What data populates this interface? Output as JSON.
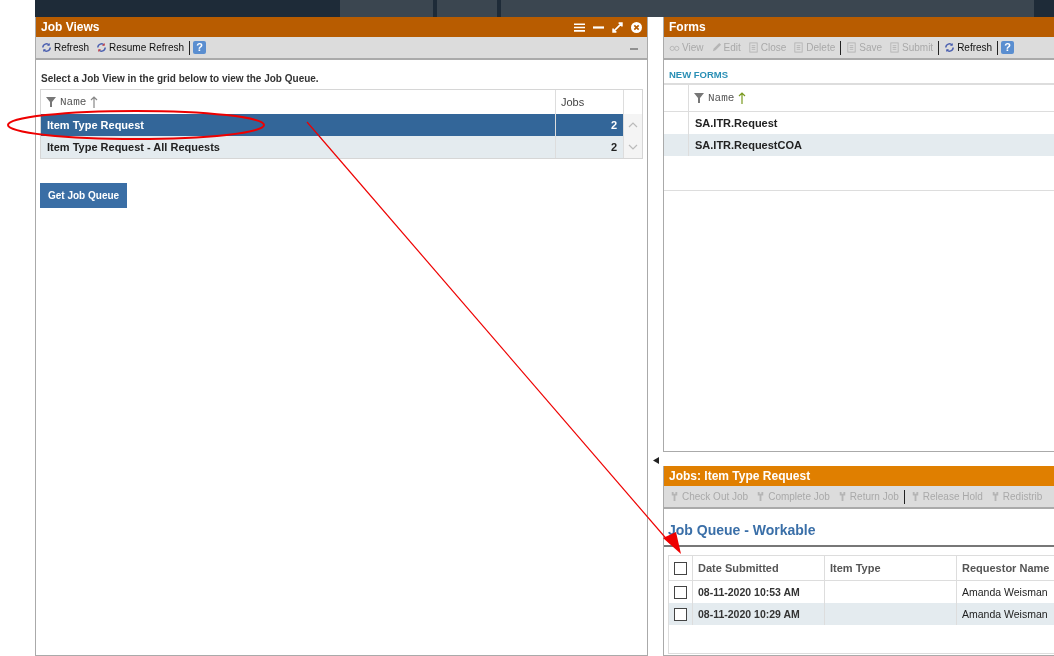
{
  "job_views": {
    "title": "Job Views",
    "toolbar": [
      {
        "kind": "refresh",
        "label": "Refresh",
        "disabled": false
      },
      {
        "kind": "resume",
        "label": "Resume Refresh",
        "disabled": false
      },
      {
        "kind": "separator"
      },
      {
        "kind": "help",
        "label": "?"
      }
    ],
    "instruction": "Select a Job View in the grid below to view the Job Queue.",
    "columns": [
      "Name",
      "Jobs"
    ],
    "rows": [
      {
        "name": "Item Type Request",
        "jobs": "2",
        "selected": true
      },
      {
        "name": "Item Type Request - All Requests",
        "jobs": "2",
        "selected": false
      }
    ],
    "button": "Get Job Queue"
  },
  "forms": {
    "title": "Forms",
    "toolbar": [
      {
        "kind": "view",
        "label": "View",
        "disabled": true
      },
      {
        "kind": "edit",
        "label": "Edit",
        "disabled": true
      },
      {
        "kind": "close",
        "label": "Close",
        "disabled": true
      },
      {
        "kind": "delete",
        "label": "Delete",
        "disabled": true
      },
      {
        "kind": "separator"
      },
      {
        "kind": "save",
        "label": "Save",
        "disabled": true
      },
      {
        "kind": "submit",
        "label": "Submit",
        "disabled": true
      },
      {
        "kind": "separator"
      },
      {
        "kind": "refresh",
        "label": "Refresh",
        "disabled": false
      },
      {
        "kind": "separator"
      },
      {
        "kind": "help",
        "label": "?"
      }
    ],
    "section": "NEW FORMS",
    "columns": [
      "Name"
    ],
    "rows": [
      {
        "name": "SA.ITR.Request"
      },
      {
        "name": "SA.ITR.RequestCOA"
      }
    ]
  },
  "jobs": {
    "title": "Jobs: Item Type Request",
    "toolbar": [
      {
        "kind": "checkout",
        "label": "Check Out Job",
        "disabled": true
      },
      {
        "kind": "complete",
        "label": "Complete Job",
        "disabled": true
      },
      {
        "kind": "return",
        "label": "Return Job",
        "disabled": true
      },
      {
        "kind": "separator"
      },
      {
        "kind": "release",
        "label": "Release Hold",
        "disabled": true
      },
      {
        "kind": "redistribute",
        "label": "Redistrib",
        "disabled": true
      }
    ],
    "heading": "Job Queue - Workable",
    "all_checked": false,
    "columns": [
      "Date Submitted",
      "Item Type",
      "Requestor Name"
    ],
    "rows": [
      {
        "checked": false,
        "date": "08-11-2020 10:53 AM",
        "requestor": "Amanda Weisman"
      },
      {
        "checked": false,
        "date": "08-11-2020 10:29 AM",
        "requestor": "Amanda Weisman"
      }
    ]
  }
}
